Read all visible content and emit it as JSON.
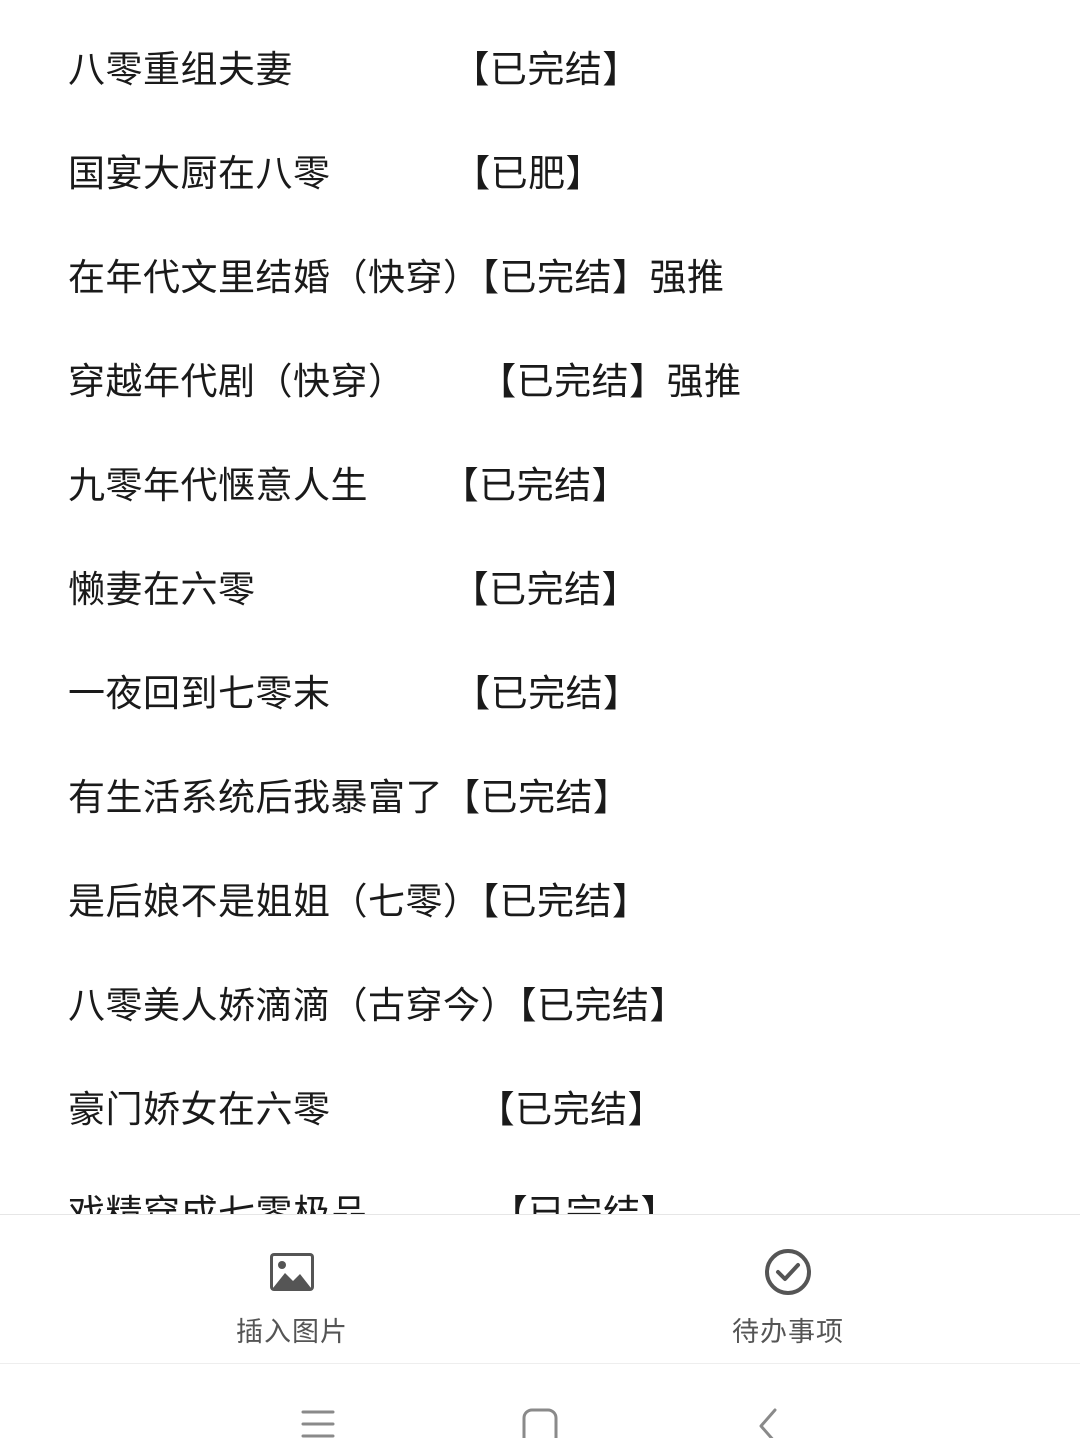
{
  "note": {
    "lines": [
      {
        "text": "八零重组夫妻             【已完结】"
      },
      {
        "text": "国宴大厨在八零          【已肥】"
      },
      {
        "text": "在年代文里结婚（快穿）【已完结】强推"
      },
      {
        "text": "穿越年代剧（快穿）      【已完结】强推"
      },
      {
        "text": "九零年代惬意人生      【已完结】"
      },
      {
        "text": "懒妻在六零                【已完结】"
      },
      {
        "text": "一夜回到七零末          【已完结】"
      },
      {
        "text": "有生活系统后我暴富了【已完结】"
      },
      {
        "text": "是后娘不是姐姐（七零）【已完结】"
      },
      {
        "text": "八零美人娇滴滴（古穿今）【已完结】"
      },
      {
        "text": "豪门娇女在六零            【已完结】"
      },
      {
        "text": "戏精穿成七零极品          【已完结】"
      }
    ]
  },
  "toolbar": {
    "insert_image": {
      "label": "插入图片",
      "icon": "image-icon"
    },
    "todo": {
      "label": "待办事项",
      "icon": "check-circle-icon"
    }
  },
  "nav": {
    "menu_icon": "menu-icon",
    "home_icon": "home-icon",
    "back_icon": "back-icon"
  },
  "colors": {
    "text": "#1a1a1a",
    "toolbar_icon": "#555555",
    "nav_icon": "#8a8a8a",
    "divider": "#e6e6e6"
  }
}
